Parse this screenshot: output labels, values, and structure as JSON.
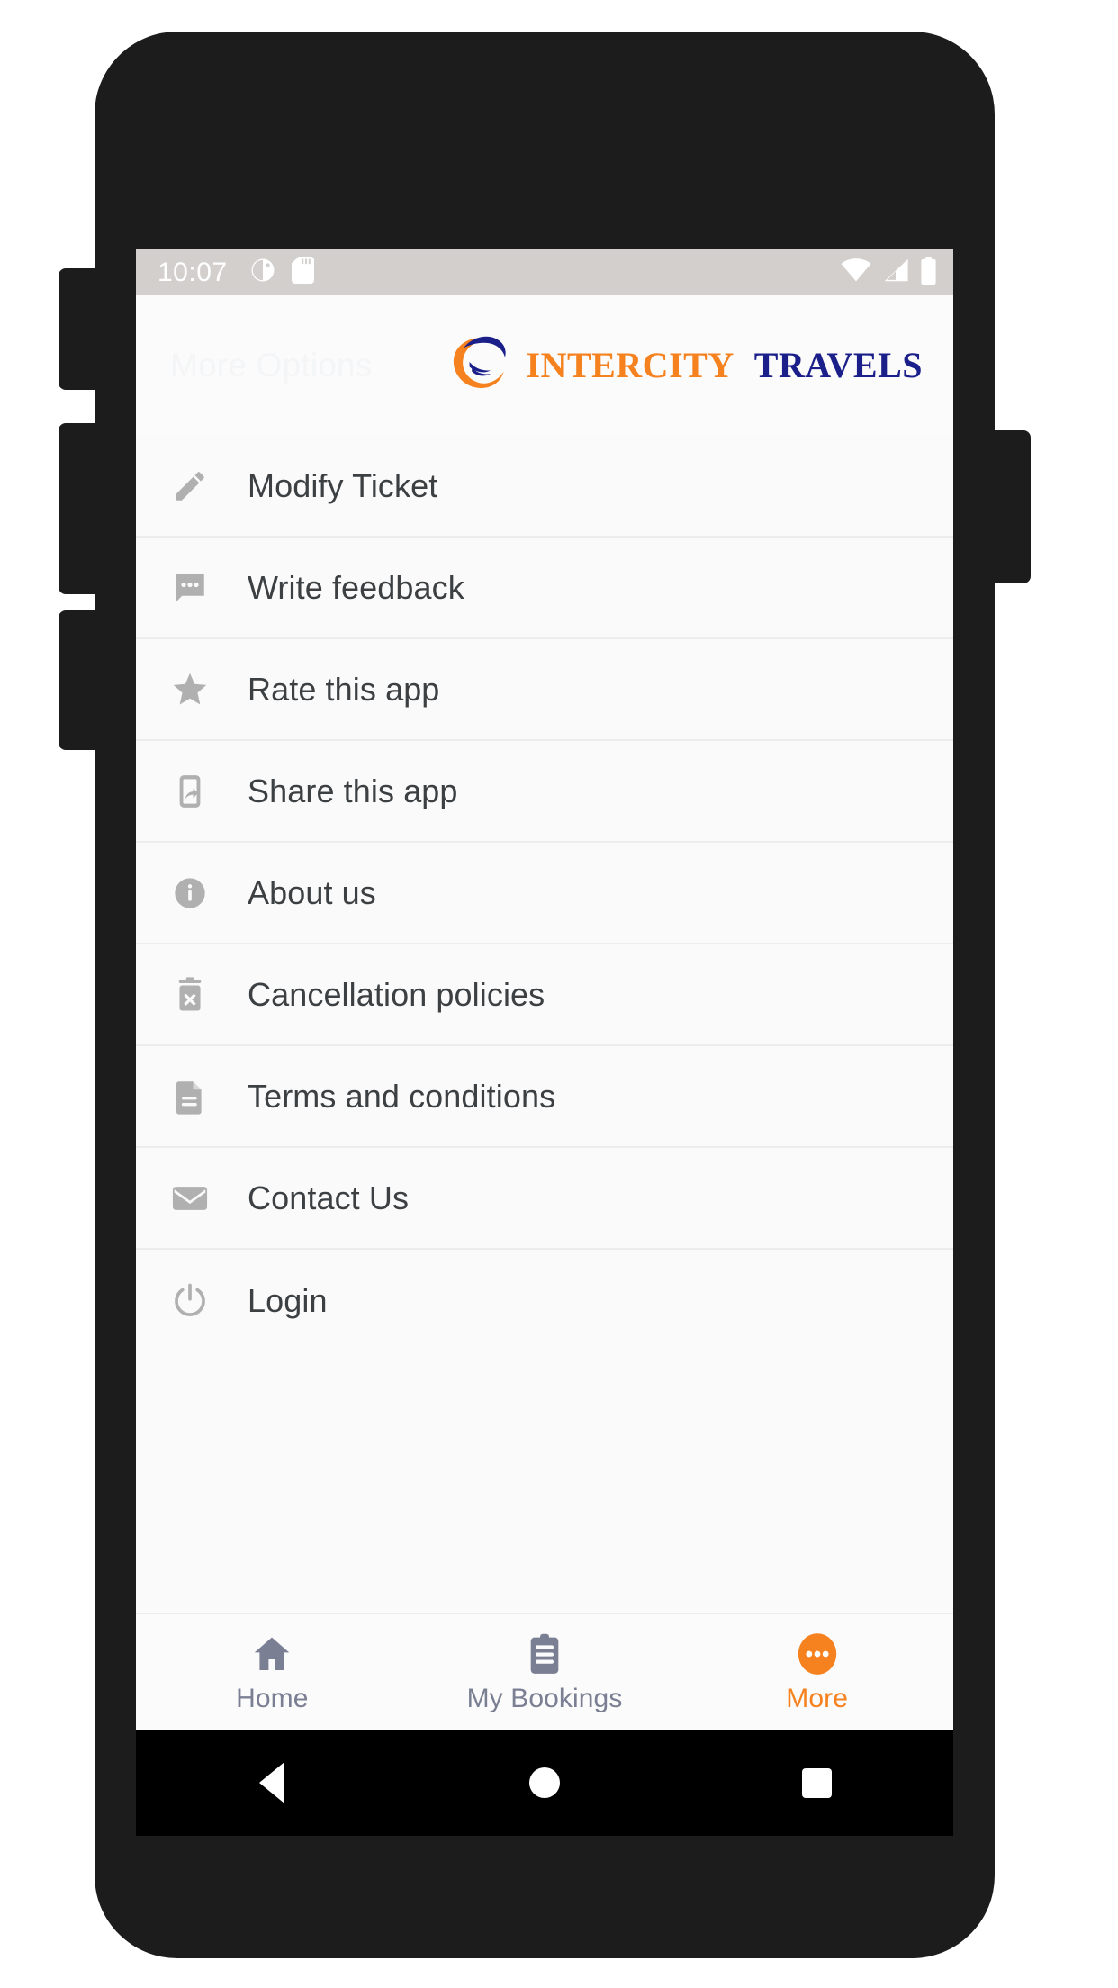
{
  "colors": {
    "brand_orange": "#F5821F",
    "brand_navy": "#1B1F8A",
    "screen_bg": "#fafafa",
    "status_bar_bg": "#d2cfcc",
    "icon_gray": "#b0b0b0",
    "text_primary": "#3c4043",
    "tab_inactive": "#7b7f93",
    "divider": "#ededed"
  },
  "status_bar": {
    "time": "10:07",
    "left_icons": [
      "do-not-disturb-icon",
      "sd-card-icon"
    ],
    "right_icons": [
      "wifi-icon",
      "cellular-signal-icon",
      "battery-icon"
    ]
  },
  "header": {
    "title": "More Options",
    "brand": {
      "mark": "orange-swoosh-logo-icon",
      "primary": "INTERCITY",
      "secondary": "TRAVELS"
    }
  },
  "menu": {
    "items": [
      {
        "label": "Modify Ticket",
        "icon": "pencil-icon"
      },
      {
        "label": "Write feedback",
        "icon": "chat-bubble-icon"
      },
      {
        "label": "Rate this app",
        "icon": "star-icon"
      },
      {
        "label": "Share this app",
        "icon": "share-phone-icon"
      },
      {
        "label": "About us",
        "icon": "info-circle-icon"
      },
      {
        "label": "Cancellation policies",
        "icon": "trash-x-icon"
      },
      {
        "label": "Terms and conditions",
        "icon": "document-icon"
      },
      {
        "label": "Contact Us",
        "icon": "envelope-icon"
      },
      {
        "label": "Login",
        "icon": "power-icon"
      }
    ]
  },
  "tab_bar": {
    "tabs": [
      {
        "label": "Home",
        "icon": "home-icon",
        "active": false
      },
      {
        "label": "My Bookings",
        "icon": "clipboard-icon",
        "active": false
      },
      {
        "label": "More",
        "icon": "more-dots-icon",
        "active": true
      }
    ]
  },
  "android_nav": {
    "buttons": [
      {
        "name": "back-button",
        "icon": "triangle-back-icon"
      },
      {
        "name": "home-button",
        "icon": "circle-home-icon"
      },
      {
        "name": "recents-button",
        "icon": "square-recents-icon"
      }
    ]
  }
}
